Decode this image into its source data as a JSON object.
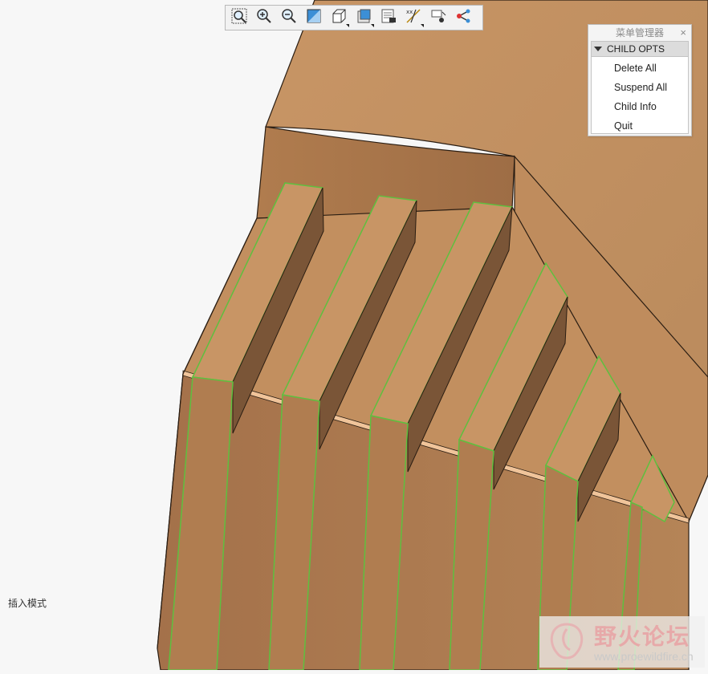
{
  "toolbar": {
    "buttons": [
      {
        "name": "zoom-window-icon"
      },
      {
        "name": "zoom-in-icon"
      },
      {
        "name": "zoom-out-icon"
      },
      {
        "name": "refit-icon"
      },
      {
        "name": "display-style-icon"
      },
      {
        "name": "saved-views-icon"
      },
      {
        "name": "view-manager-icon"
      },
      {
        "name": "datum-display-icon"
      },
      {
        "name": "annotation-display-icon"
      },
      {
        "name": "spin-center-icon"
      }
    ]
  },
  "menu_manager": {
    "title": "菜单管理器",
    "close_label": "×",
    "header": "CHILD OPTS",
    "items": [
      "Delete All",
      "Suspend All",
      "Child Info",
      "Quit"
    ]
  },
  "status": {
    "text": "插入模式"
  },
  "watermark": {
    "text": "野火论坛",
    "url": "www.proewildfire.cn"
  },
  "colors": {
    "background": "#f7f7f7",
    "part_light": "#c38e5c",
    "part_mid": "#b07d50",
    "part_dark": "#8a6040",
    "edge_highlight": "#5fbf3f"
  }
}
